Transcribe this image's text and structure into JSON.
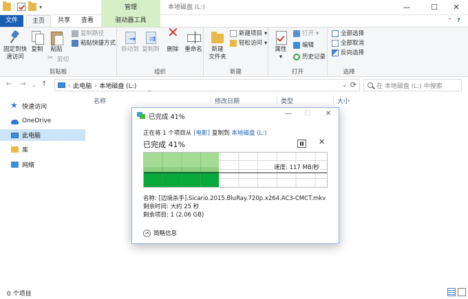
{
  "window": {
    "title": "本地磁盘 (L:)",
    "context_group": "管理"
  },
  "tabs": [
    "文件",
    "主页",
    "共享",
    "查看",
    "驱动器工具"
  ],
  "ribbon": {
    "clipboard": {
      "label": "剪贴板",
      "pin": "固定到快速访问",
      "pin_l1": "固定到快",
      "pin_l2": "速访问",
      "copy": "复制",
      "paste": "粘贴",
      "copy_path": "复制路径",
      "paste_shortcut": "粘贴快捷方式",
      "cut": "剪切"
    },
    "organize": {
      "label": "组织",
      "move_to": "移动到",
      "copy_to": "复制到",
      "delete": "删除",
      "rename": "重命名"
    },
    "new": {
      "label": "新建",
      "new_folder_l1": "新建",
      "new_folder_l2": "文件夹",
      "new_item": "新建项目",
      "easy_access": "轻松访问"
    },
    "open": {
      "label": "打开",
      "properties": "属性",
      "open": "打开",
      "edit": "编辑",
      "history": "历史记录"
    },
    "select": {
      "label": "选择",
      "select_all": "全部选择",
      "select_none": "全部取消",
      "invert": "反向选择"
    }
  },
  "address": {
    "segments": [
      "此电脑",
      "本地磁盘 (L:)"
    ],
    "search_placeholder": "在 本地磁盘 (L:) 中搜索"
  },
  "navpane": [
    "快速访问",
    "OneDrive",
    "此电脑",
    "库",
    "网络"
  ],
  "columns": [
    "名称",
    "修改日期",
    "类型",
    "大小"
  ],
  "status": {
    "count": "0 个项目"
  },
  "dialog": {
    "title": "已完成 41%",
    "line1_a": "正在将 1 个项目从",
    "source": "[电影]",
    "line1_b": "复制到",
    "dest": "本地磁盘 (L:)",
    "percent_text": "已完成 41%",
    "progress": 0.41,
    "speed": "速度: 117 MB/秒",
    "name_line": "名称: [边境杀手].Sicario.2015.BluRay.720p.x264.AC3-CMCT.mkv",
    "time_line": "剩余时间: 大约 25 秒",
    "items_line": "剩余项目: 1 (2.06 GB)",
    "collapse": "简略信息"
  }
}
